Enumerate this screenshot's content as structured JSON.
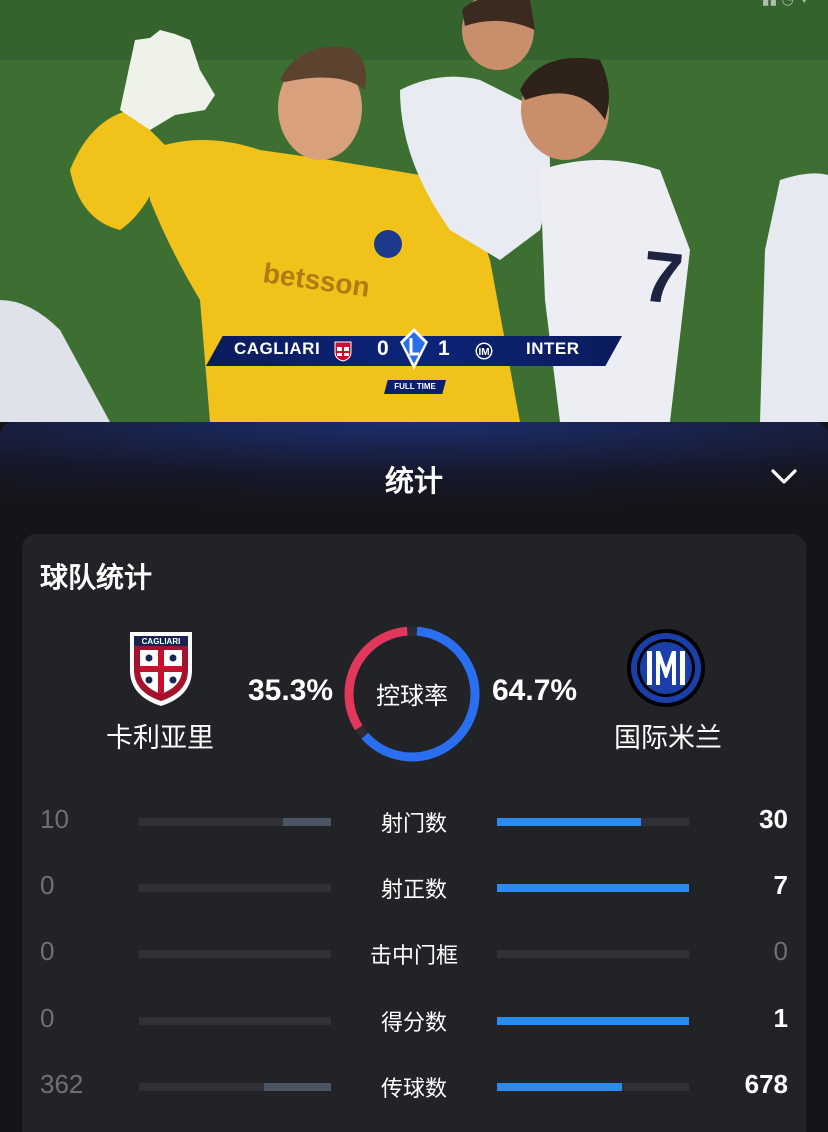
{
  "video": {
    "scorebug": {
      "home_team": "CAGLIARI",
      "home_score": "0",
      "away_score": "1",
      "away_team": "INTER",
      "status": "FULL TIME"
    }
  },
  "panel": {
    "title": "统计"
  },
  "card": {
    "title": "球队统计",
    "home": {
      "name": "卡利亚里",
      "possession_text": "35.3%",
      "possession": 35.3
    },
    "away": {
      "name": "国际米兰",
      "possession_text": "64.7%",
      "possession": 64.7
    },
    "possession_label": "控球率",
    "colors": {
      "home": "#e0375a",
      "away": "#2a6ff0",
      "bar_away": "#2a8cf0",
      "bar_home": "#4a5462"
    },
    "stats": [
      {
        "label": "射门数",
        "home": "10",
        "away": "30",
        "home_v": 10,
        "away_v": 30,
        "max": 40
      },
      {
        "label": "射正数",
        "home": "0",
        "away": "7",
        "home_v": 0,
        "away_v": 7,
        "max": 7
      },
      {
        "label": "击中门框",
        "home": "0",
        "away": "0",
        "home_v": 0,
        "away_v": 0,
        "max": 0
      },
      {
        "label": "得分数",
        "home": "0",
        "away": "1",
        "home_v": 0,
        "away_v": 1,
        "max": 1
      },
      {
        "label": "传球数",
        "home": "362",
        "away": "678",
        "home_v": 362,
        "away_v": 678,
        "max": 1040
      }
    ]
  }
}
